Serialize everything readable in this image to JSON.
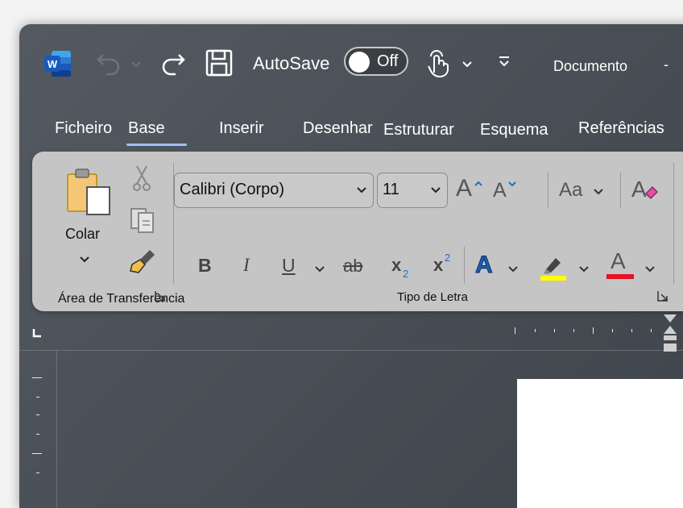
{
  "window": {
    "autosave_label": "AutoSave",
    "toggle_state": "Off",
    "document_title": "Documento",
    "title_dash": "-"
  },
  "tabs": [
    {
      "label": "Ficheiro"
    },
    {
      "label": "Base",
      "active": true
    },
    {
      "label": "Inserir"
    },
    {
      "label": "Desenhar"
    },
    {
      "label": "Estruturar"
    },
    {
      "label": "Esquema"
    },
    {
      "label": "Referências"
    }
  ],
  "clipboard": {
    "paste_label": "Colar",
    "group_label": "Área de Transferência"
  },
  "font": {
    "font_name": "Calibri (Corpo)",
    "font_size": "11",
    "change_case": "Aa",
    "bold": "B",
    "italic": "I",
    "underline": "U",
    "strike": "ab",
    "subscript_base": "x",
    "subscript_sub": "2",
    "superscript_base": "x",
    "superscript_sup": "2",
    "grow_letter": "A",
    "shrink_letter": "A",
    "text_effects_letter": "A",
    "font_color_letter": "A",
    "group_label": "Tipo de Letra"
  },
  "colors": {
    "accent_underline": "#9fc2ef",
    "highlight": "#ffff00",
    "font_color": "#e81123",
    "word_blue": "#185abd"
  }
}
